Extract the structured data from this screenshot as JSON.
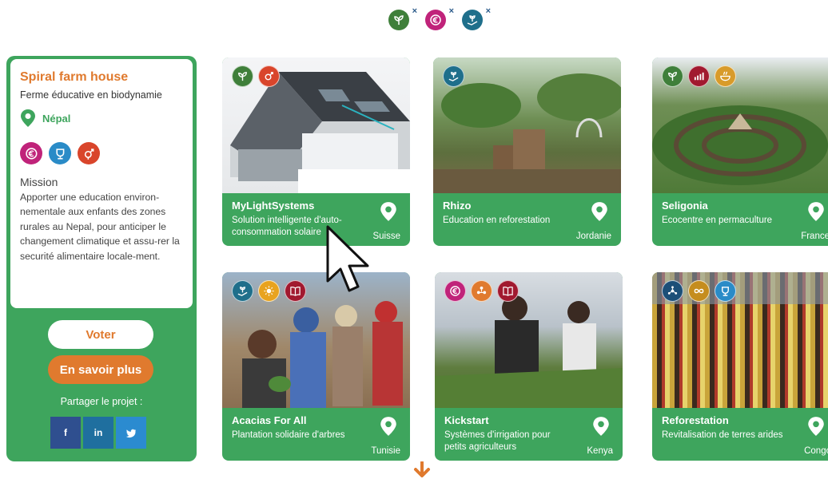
{
  "colors": {
    "green": "#3ea55d",
    "orange": "#e07a2e",
    "magenta": "#c0237a",
    "teal": "#1f6f8b",
    "red": "#d9452b",
    "darkgreen": "#3f7f3a",
    "maroon": "#a1192f",
    "amber": "#d89b2a",
    "navy": "#1c4f78",
    "gold": "#c58d1e",
    "sky": "#2a8bc7"
  },
  "filters": [
    {
      "icon": "seedling-icon",
      "color": "#3f7f3a",
      "remove": "×"
    },
    {
      "icon": "euro-icon",
      "color": "#c0237a",
      "remove": "×"
    },
    {
      "icon": "hand-plant-icon",
      "color": "#1f6f8b",
      "remove": "×"
    }
  ],
  "sidebar": {
    "title": "Spiral farm house",
    "subtitle": "Ferme éducative en biodynamie",
    "location": "Népal",
    "icons": [
      "euro-icon",
      "trophy-icon",
      "gender-icon"
    ],
    "mission_heading": "Mission",
    "mission_text": "Apporter une education environ-nementale aux enfants des zones rurales au Nepal, pour anticiper le changement climatique et assu-rer la securité alimentaire locale-ment.",
    "vote_label": "Voter",
    "more_label": "En savoir plus",
    "share_label": "Partager le projet :",
    "share": [
      {
        "icon": "facebook-icon",
        "glyph": "f",
        "color": "#2f4f8f"
      },
      {
        "icon": "linkedin-icon",
        "glyph": "in",
        "color": "#1f6f9f"
      },
      {
        "icon": "twitter-icon",
        "glyph": "🐦",
        "color": "#2b8bd0"
      }
    ]
  },
  "cards": [
    {
      "title": "MyLightSystems",
      "subtitle": "Solution intelligente d'auto-consommation solaire",
      "country": "Suisse"
    },
    {
      "title": "Rhizo",
      "subtitle": "Education en reforestation",
      "country": "Jordanie"
    },
    {
      "title": "Seligonia",
      "subtitle": "Ecocentre en permaculture",
      "country": "France"
    },
    {
      "title": "Acacias For All",
      "subtitle": "Plantation solidaire d'arbres",
      "country": "Tunisie"
    },
    {
      "title": "Kickstart",
      "subtitle": "Systèmes d'irrigation pour petits agriculteurs",
      "country": "Kenya"
    },
    {
      "title": "Reforestation",
      "subtitle": "Revitalisation de terres arides",
      "country": "Congo"
    }
  ]
}
